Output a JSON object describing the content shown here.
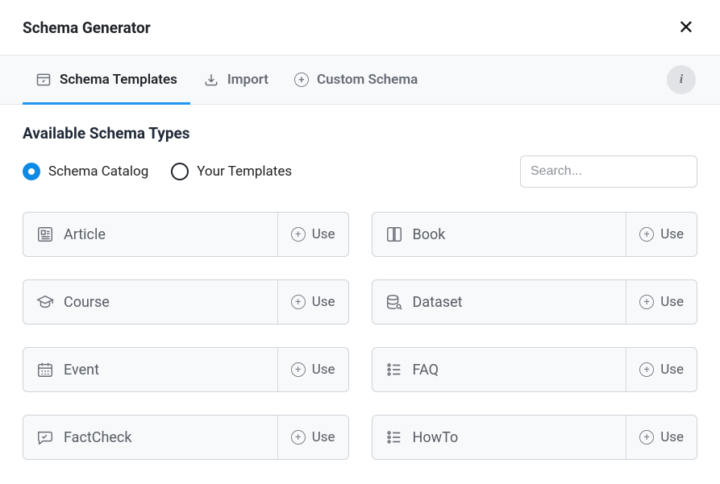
{
  "header": {
    "title": "Schema Generator"
  },
  "tabs": {
    "templates": "Schema Templates",
    "import": "Import",
    "custom": "Custom Schema"
  },
  "section_title": "Available Schema Types",
  "radios": {
    "catalog": "Schema Catalog",
    "your": "Your Templates"
  },
  "search_placeholder": "Search...",
  "use_label": "Use",
  "cards": {
    "article": "Article",
    "book": "Book",
    "course": "Course",
    "dataset": "Dataset",
    "event": "Event",
    "faq": "FAQ",
    "factcheck": "FactCheck",
    "howto": "HowTo"
  }
}
